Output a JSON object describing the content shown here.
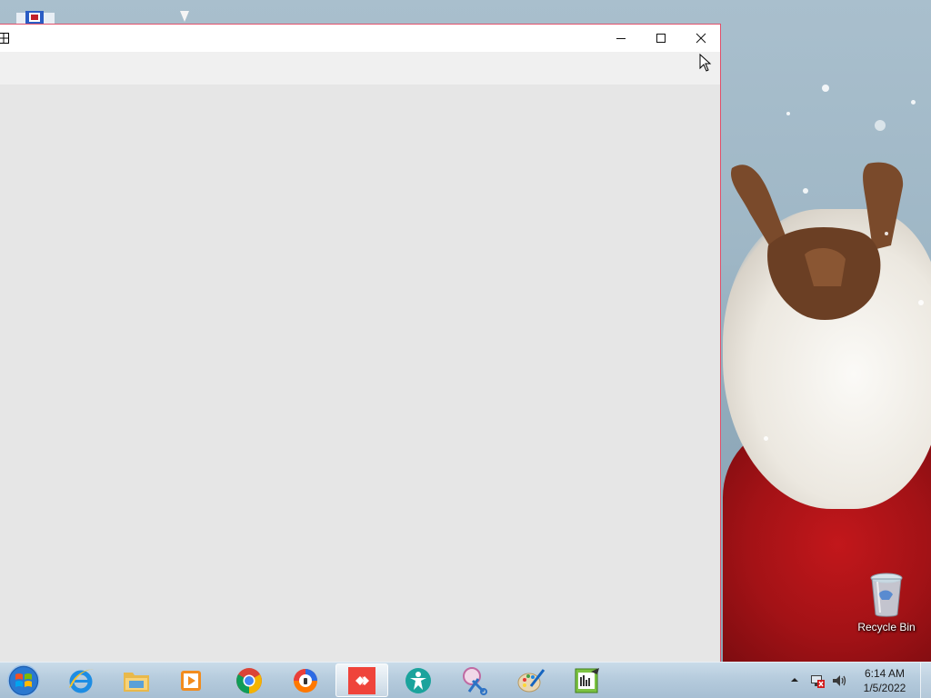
{
  "window": {
    "controls": {
      "minimize_icon": "minimize-icon",
      "maximize_icon": "maximize-icon",
      "close_icon": "close-icon"
    }
  },
  "desktop": {
    "icons": [
      {
        "label": "Recycle Bin",
        "icon": "recycle-bin-icon"
      }
    ]
  },
  "taskbar": {
    "start_icon": "windows-start-icon",
    "pinned": [
      {
        "icon": "internet-explorer-icon"
      },
      {
        "icon": "file-explorer-icon"
      },
      {
        "icon": "media-player-icon"
      },
      {
        "icon": "chrome-icon"
      },
      {
        "icon": "avast-browser-icon"
      },
      {
        "icon": "anydesk-icon",
        "active": true
      },
      {
        "icon": "accessibility-icon"
      },
      {
        "icon": "snipping-tool-icon"
      },
      {
        "icon": "paint-icon"
      },
      {
        "icon": "editor-icon"
      }
    ],
    "tray": {
      "icons": [
        "show-hidden-icons-arrow",
        "network-icon",
        "volume-icon"
      ]
    },
    "clock": {
      "time": "6:14 AM",
      "date": "1/5/2022"
    }
  },
  "colors": {
    "window_border_accent": "#e0506a",
    "taskbar": "#b4cadc",
    "close_hover": "#e81123"
  }
}
